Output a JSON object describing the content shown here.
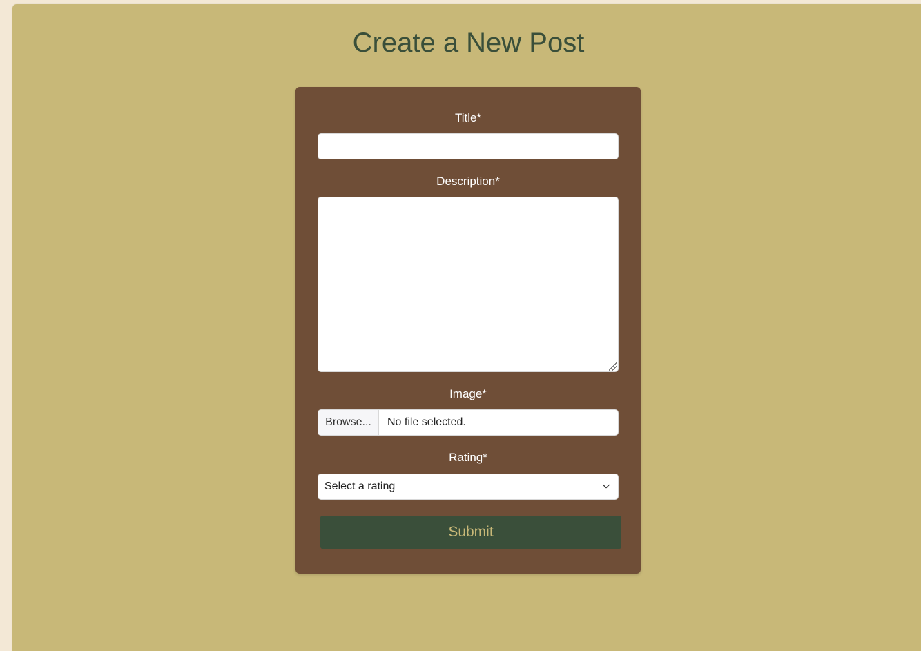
{
  "page": {
    "title": "Create a New Post"
  },
  "form": {
    "title_label": "Title*",
    "title_value": "",
    "description_label": "Description*",
    "description_value": "",
    "image_label": "Image*",
    "browse_label": "Browse...",
    "file_status": "No file selected.",
    "rating_label": "Rating*",
    "rating_selected": "Select a rating",
    "submit_label": "Submit"
  },
  "colors": {
    "page_background": "#c8b878",
    "card_background": "#6f4e37",
    "accent_green": "#3a4f3a",
    "outer_background": "#f3e8d6"
  },
  "icons": {
    "select": "chevron-down-icon",
    "textarea": "resize-grip-icon"
  }
}
